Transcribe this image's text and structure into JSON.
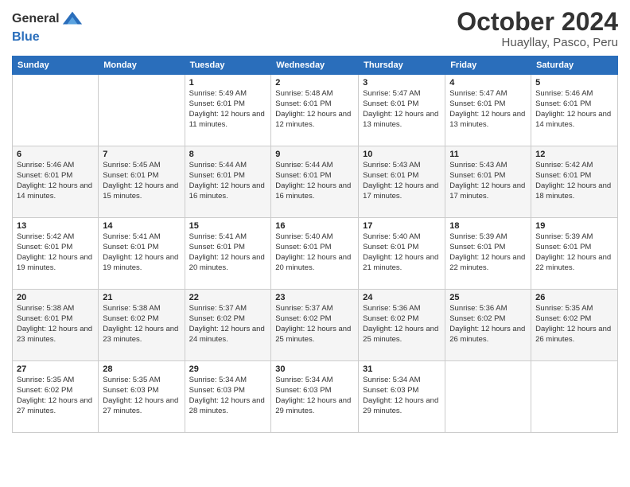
{
  "header": {
    "logo_general": "General",
    "logo_blue": "Blue",
    "month_title": "October 2024",
    "location": "Huayllay, Pasco, Peru"
  },
  "days_of_week": [
    "Sunday",
    "Monday",
    "Tuesday",
    "Wednesday",
    "Thursday",
    "Friday",
    "Saturday"
  ],
  "weeks": [
    [
      {
        "day": "",
        "sunrise": "",
        "sunset": "",
        "daylight": ""
      },
      {
        "day": "",
        "sunrise": "",
        "sunset": "",
        "daylight": ""
      },
      {
        "day": "1",
        "sunrise": "Sunrise: 5:49 AM",
        "sunset": "Sunset: 6:01 PM",
        "daylight": "Daylight: 12 hours and 11 minutes."
      },
      {
        "day": "2",
        "sunrise": "Sunrise: 5:48 AM",
        "sunset": "Sunset: 6:01 PM",
        "daylight": "Daylight: 12 hours and 12 minutes."
      },
      {
        "day": "3",
        "sunrise": "Sunrise: 5:47 AM",
        "sunset": "Sunset: 6:01 PM",
        "daylight": "Daylight: 12 hours and 13 minutes."
      },
      {
        "day": "4",
        "sunrise": "Sunrise: 5:47 AM",
        "sunset": "Sunset: 6:01 PM",
        "daylight": "Daylight: 12 hours and 13 minutes."
      },
      {
        "day": "5",
        "sunrise": "Sunrise: 5:46 AM",
        "sunset": "Sunset: 6:01 PM",
        "daylight": "Daylight: 12 hours and 14 minutes."
      }
    ],
    [
      {
        "day": "6",
        "sunrise": "Sunrise: 5:46 AM",
        "sunset": "Sunset: 6:01 PM",
        "daylight": "Daylight: 12 hours and 14 minutes."
      },
      {
        "day": "7",
        "sunrise": "Sunrise: 5:45 AM",
        "sunset": "Sunset: 6:01 PM",
        "daylight": "Daylight: 12 hours and 15 minutes."
      },
      {
        "day": "8",
        "sunrise": "Sunrise: 5:44 AM",
        "sunset": "Sunset: 6:01 PM",
        "daylight": "Daylight: 12 hours and 16 minutes."
      },
      {
        "day": "9",
        "sunrise": "Sunrise: 5:44 AM",
        "sunset": "Sunset: 6:01 PM",
        "daylight": "Daylight: 12 hours and 16 minutes."
      },
      {
        "day": "10",
        "sunrise": "Sunrise: 5:43 AM",
        "sunset": "Sunset: 6:01 PM",
        "daylight": "Daylight: 12 hours and 17 minutes."
      },
      {
        "day": "11",
        "sunrise": "Sunrise: 5:43 AM",
        "sunset": "Sunset: 6:01 PM",
        "daylight": "Daylight: 12 hours and 17 minutes."
      },
      {
        "day": "12",
        "sunrise": "Sunrise: 5:42 AM",
        "sunset": "Sunset: 6:01 PM",
        "daylight": "Daylight: 12 hours and 18 minutes."
      }
    ],
    [
      {
        "day": "13",
        "sunrise": "Sunrise: 5:42 AM",
        "sunset": "Sunset: 6:01 PM",
        "daylight": "Daylight: 12 hours and 19 minutes."
      },
      {
        "day": "14",
        "sunrise": "Sunrise: 5:41 AM",
        "sunset": "Sunset: 6:01 PM",
        "daylight": "Daylight: 12 hours and 19 minutes."
      },
      {
        "day": "15",
        "sunrise": "Sunrise: 5:41 AM",
        "sunset": "Sunset: 6:01 PM",
        "daylight": "Daylight: 12 hours and 20 minutes."
      },
      {
        "day": "16",
        "sunrise": "Sunrise: 5:40 AM",
        "sunset": "Sunset: 6:01 PM",
        "daylight": "Daylight: 12 hours and 20 minutes."
      },
      {
        "day": "17",
        "sunrise": "Sunrise: 5:40 AM",
        "sunset": "Sunset: 6:01 PM",
        "daylight": "Daylight: 12 hours and 21 minutes."
      },
      {
        "day": "18",
        "sunrise": "Sunrise: 5:39 AM",
        "sunset": "Sunset: 6:01 PM",
        "daylight": "Daylight: 12 hours and 22 minutes."
      },
      {
        "day": "19",
        "sunrise": "Sunrise: 5:39 AM",
        "sunset": "Sunset: 6:01 PM",
        "daylight": "Daylight: 12 hours and 22 minutes."
      }
    ],
    [
      {
        "day": "20",
        "sunrise": "Sunrise: 5:38 AM",
        "sunset": "Sunset: 6:01 PM",
        "daylight": "Daylight: 12 hours and 23 minutes."
      },
      {
        "day": "21",
        "sunrise": "Sunrise: 5:38 AM",
        "sunset": "Sunset: 6:02 PM",
        "daylight": "Daylight: 12 hours and 23 minutes."
      },
      {
        "day": "22",
        "sunrise": "Sunrise: 5:37 AM",
        "sunset": "Sunset: 6:02 PM",
        "daylight": "Daylight: 12 hours and 24 minutes."
      },
      {
        "day": "23",
        "sunrise": "Sunrise: 5:37 AM",
        "sunset": "Sunset: 6:02 PM",
        "daylight": "Daylight: 12 hours and 25 minutes."
      },
      {
        "day": "24",
        "sunrise": "Sunrise: 5:36 AM",
        "sunset": "Sunset: 6:02 PM",
        "daylight": "Daylight: 12 hours and 25 minutes."
      },
      {
        "day": "25",
        "sunrise": "Sunrise: 5:36 AM",
        "sunset": "Sunset: 6:02 PM",
        "daylight": "Daylight: 12 hours and 26 minutes."
      },
      {
        "day": "26",
        "sunrise": "Sunrise: 5:35 AM",
        "sunset": "Sunset: 6:02 PM",
        "daylight": "Daylight: 12 hours and 26 minutes."
      }
    ],
    [
      {
        "day": "27",
        "sunrise": "Sunrise: 5:35 AM",
        "sunset": "Sunset: 6:02 PM",
        "daylight": "Daylight: 12 hours and 27 minutes."
      },
      {
        "day": "28",
        "sunrise": "Sunrise: 5:35 AM",
        "sunset": "Sunset: 6:03 PM",
        "daylight": "Daylight: 12 hours and 27 minutes."
      },
      {
        "day": "29",
        "sunrise": "Sunrise: 5:34 AM",
        "sunset": "Sunset: 6:03 PM",
        "daylight": "Daylight: 12 hours and 28 minutes."
      },
      {
        "day": "30",
        "sunrise": "Sunrise: 5:34 AM",
        "sunset": "Sunset: 6:03 PM",
        "daylight": "Daylight: 12 hours and 29 minutes."
      },
      {
        "day": "31",
        "sunrise": "Sunrise: 5:34 AM",
        "sunset": "Sunset: 6:03 PM",
        "daylight": "Daylight: 12 hours and 29 minutes."
      },
      {
        "day": "",
        "sunrise": "",
        "sunset": "",
        "daylight": ""
      },
      {
        "day": "",
        "sunrise": "",
        "sunset": "",
        "daylight": ""
      }
    ]
  ]
}
